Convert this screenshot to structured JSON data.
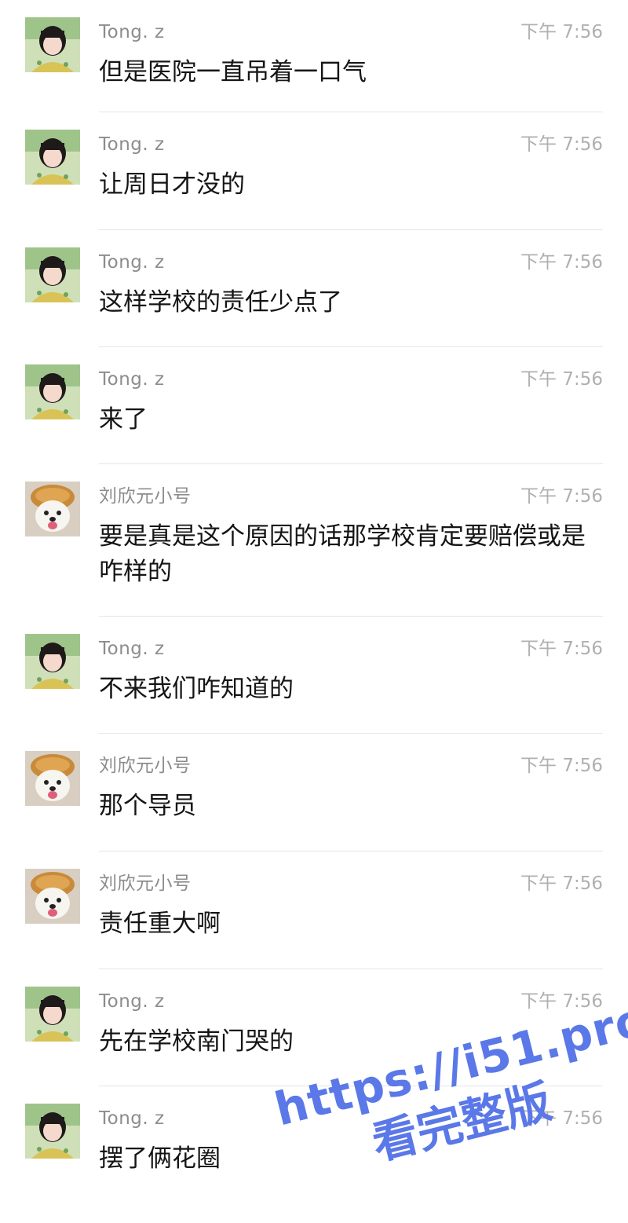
{
  "messages": [
    {
      "sender": "Tong. z",
      "time": "下午 7:56",
      "text": "但是医院一直吊着一口气",
      "avatar": "girl-avatar"
    },
    {
      "sender": "Tong. z",
      "time": "下午 7:56",
      "text": "让周日才没的",
      "avatar": "girl-avatar"
    },
    {
      "sender": "Tong. z",
      "time": "下午 7:56",
      "text": "这样学校的责任少点了",
      "avatar": "girl-avatar"
    },
    {
      "sender": "Tong. z",
      "time": "下午 7:56",
      "text": "来了",
      "avatar": "girl-avatar"
    },
    {
      "sender": "刘欣元小号",
      "time": "下午 7:56",
      "text": "要是真是这个原因的话那学校肯定要赔偿或是咋样的",
      "avatar": "dog-avatar"
    },
    {
      "sender": "Tong. z",
      "time": "下午 7:56",
      "text": "不来我们咋知道的",
      "avatar": "girl-avatar"
    },
    {
      "sender": "刘欣元小号",
      "time": "下午 7:56",
      "text": "那个导员",
      "avatar": "dog-avatar"
    },
    {
      "sender": "刘欣元小号",
      "time": "下午 7:56",
      "text": "责任重大啊",
      "avatar": "dog-avatar"
    },
    {
      "sender": "Tong. z",
      "time": "下午 7:56",
      "text": "先在学校南门哭的",
      "avatar": "girl-avatar"
    },
    {
      "sender": "Tong. z",
      "time": "下午 7:56",
      "text": "摆了俩花圈",
      "avatar": "girl-avatar"
    }
  ],
  "watermark": {
    "line1": "https://i51.pro",
    "line2": "看完整版",
    "color": "#5b78e8"
  },
  "colors": {
    "sender": "#8c8c8c",
    "time": "#b0b0b0",
    "text": "#151515",
    "divider": "#e6e6e6"
  }
}
